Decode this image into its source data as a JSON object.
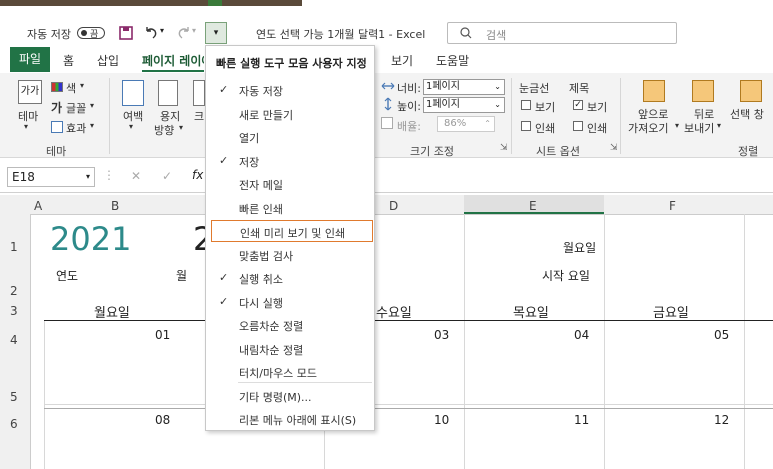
{
  "titlebar": {
    "autosave_label": "자동 저장",
    "autosave_state": "끔",
    "doc_title": "연도 선택 가능 1개월 달력1  -  Excel",
    "search_placeholder": "검색"
  },
  "tabs": {
    "file": "파일",
    "home": "홈",
    "insert": "삽입",
    "page_layout": "페이지 레이아웃",
    "view": "보기",
    "help": "도움말"
  },
  "ribbon": {
    "theme": {
      "themes": "테마",
      "colors": "색",
      "fonts": "글꼴",
      "effects": "효과",
      "group": "테마",
      "icon_text": "가가"
    },
    "page_setup": {
      "margins": "여백",
      "orientation": "용지",
      "orientation2": "방향",
      "size": "크"
    },
    "scale": {
      "width_label": "너비:",
      "width_value": "1페이지",
      "height_label": "높이:",
      "height_value": "1페이지",
      "scale_label": "배율:",
      "scale_value": "86%",
      "group": "크기 조정"
    },
    "sheet_options": {
      "gridlines": "눈금선",
      "headings": "제목",
      "view": "보기",
      "print": "인쇄",
      "group": "시트 옵션",
      "check_mark": "✓"
    },
    "arrange": {
      "bring_forward": "앞으로",
      "bring_forward2": "가져오기",
      "send_backward": "뒤로",
      "send_backward2": "보내기",
      "selection_pane": "선택 창",
      "group": "정렬"
    }
  },
  "formula_bar": {
    "name_box": "E18",
    "cancel": "✕",
    "enter": "✓",
    "fx": "fx"
  },
  "grid": {
    "columns": [
      "A",
      "B",
      "D",
      "E",
      "F"
    ],
    "rows": [
      "1",
      "2",
      "3",
      "4",
      "5",
      "6"
    ],
    "year_value": "2021",
    "month_partial": "2",
    "year_label": "연도",
    "month_label_partial": "월",
    "weekday_label": "월요일",
    "start_day_label": "시작 요일",
    "headers": [
      "월요일",
      "수요일",
      "목요일",
      "금요일"
    ],
    "week1": [
      "01",
      "03",
      "04",
      "05"
    ],
    "week2": [
      "08",
      "10",
      "11",
      "12"
    ]
  },
  "menu": {
    "title": "빠른 실행 도구 모음 사용자 지정",
    "check_mark": "✓",
    "items": [
      {
        "label": "자동 저장",
        "checked": true
      },
      {
        "label": "새로 만들기",
        "checked": false
      },
      {
        "label": "열기",
        "checked": false
      },
      {
        "label": "저장",
        "checked": true
      },
      {
        "label": "전자 메일",
        "checked": false
      },
      {
        "label": "빠른 인쇄",
        "checked": false
      },
      {
        "label": "인쇄 미리 보기 및 인쇄",
        "checked": false
      },
      {
        "label": "맞춤법 검사",
        "checked": false
      },
      {
        "label": "실행 취소",
        "checked": true
      },
      {
        "label": "다시 실행",
        "checked": true
      },
      {
        "label": "오름차순 정렬",
        "checked": false
      },
      {
        "label": "내림차순 정렬",
        "checked": false
      },
      {
        "label": "터치/마우스 모드",
        "checked": false
      }
    ],
    "more_commands": "기타 명령(M)...",
    "show_below": "리본 메뉴 아래에 표시(S)"
  },
  "colors": {
    "excel_green": "#217346",
    "accent_teal": "#2d8a8a",
    "highlight_orange": "#e07a2e"
  }
}
